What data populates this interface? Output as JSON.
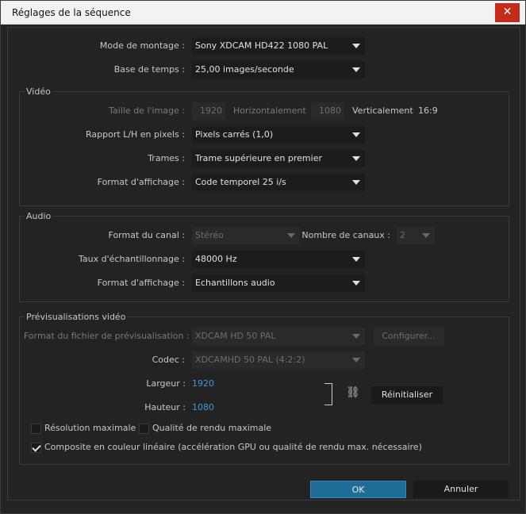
{
  "window": {
    "title": "Réglages de la séquence",
    "close_icon": "✕"
  },
  "general": {
    "mode_label": "Mode de montage :",
    "mode_value": "Sony XDCAM HD422 1080 PAL",
    "timebase_label": "Base de temps :",
    "timebase_value": "25,00  images/seconde"
  },
  "video": {
    "title": "Vidéo",
    "frame_size_label": "Taille de l'image :",
    "width_value": "1920",
    "horizontal_label": "Horizontalement",
    "height_value": "1080",
    "vertical_label": "Verticalement",
    "aspect": "16:9",
    "par_label": "Rapport L/H en pixels :",
    "par_value": "Pixels carrés (1,0)",
    "fields_label": "Trames :",
    "fields_value": "Trame supérieure en premier",
    "display_label": "Format d'affichage :",
    "display_value": "Code temporel 25 i/s"
  },
  "audio": {
    "title": "Audio",
    "channel_label": "Format du canal :",
    "channel_value": "Stéréo",
    "num_channels_label": "Nombre de canaux :",
    "num_channels_value": "2",
    "sample_rate_label": "Taux d'échantillonnage :",
    "sample_rate_value": "48000 Hz",
    "display_label": "Format d'affichage :",
    "display_value": "Echantillons audio"
  },
  "preview": {
    "title": "Prévisualisations vidéo",
    "file_format_label": "Format du fichier de prévisualisation :",
    "file_format_value": "XDCAM HD 50 PAL",
    "configure_label": "Configurer...",
    "codec_label": "Codec :",
    "codec_value": "XDCAMHD 50 PAL (4:2:2)",
    "width_label": "Largeur :",
    "width_value": "1920",
    "height_label": "Hauteur :",
    "height_value": "1080",
    "reset_label": "Réinitialiser",
    "max_resolution_label": "Résolution maximale",
    "max_quality_label": "Qualité de rendu maximale",
    "linear_composite_label": "Composite en couleur linéaire (accélération GPU ou qualité de rendu max. nécessaire)",
    "max_resolution_checked": false,
    "max_quality_checked": false,
    "linear_composite_checked": true
  },
  "footer": {
    "ok_label": "OK",
    "cancel_label": "Annuler"
  },
  "colors": {
    "accent_blue": "#3d9bd6",
    "ok_button": "#1f6d96",
    "close_button": "#c42b1c"
  }
}
